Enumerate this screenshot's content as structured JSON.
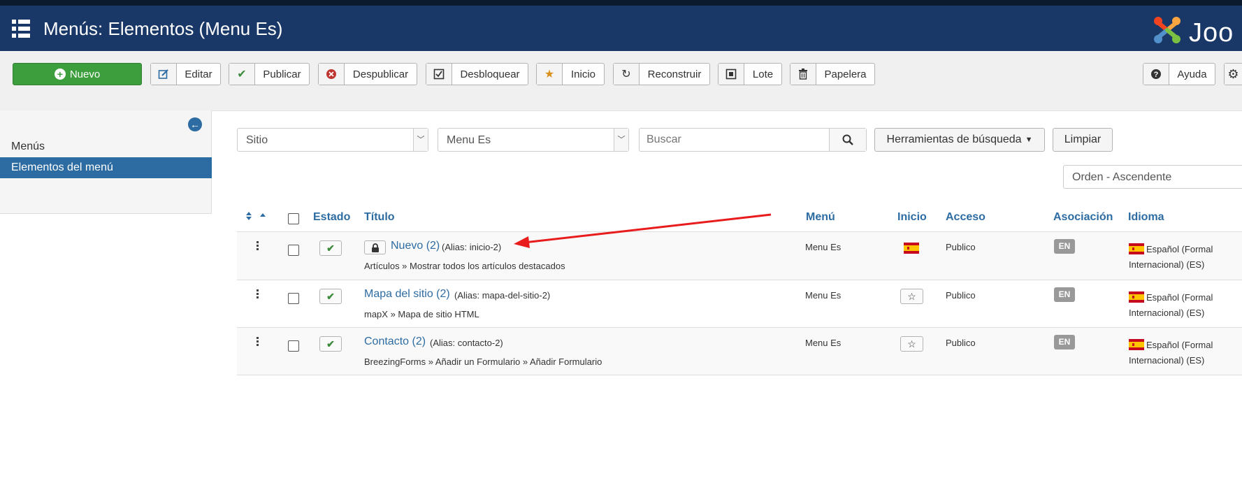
{
  "header": {
    "title": "Menús: Elementos (Menu Es)",
    "logo_text": "Joo"
  },
  "toolbar": {
    "new_label": "Nuevo",
    "edit_label": "Editar",
    "publish_label": "Publicar",
    "unpublish_label": "Despublicar",
    "checkin_label": "Desbloquear",
    "home_label": "Inicio",
    "rebuild_label": "Reconstruir",
    "batch_label": "Lote",
    "trash_label": "Papelera",
    "help_label": "Ayuda"
  },
  "sidebar": {
    "items": [
      {
        "label": "Menús"
      },
      {
        "label": "Elementos del menú"
      }
    ]
  },
  "filters": {
    "client": "Sitio",
    "menu": "Menu Es",
    "search_placeholder": "Buscar",
    "search_tools": "Herramientas de búsqueda",
    "clear": "Limpiar",
    "ordering": "Orden - Ascendente"
  },
  "table": {
    "headers": {
      "status": "Estado",
      "title": "Título",
      "menu": "Menú",
      "home": "Inicio",
      "access": "Acceso",
      "association": "Asociación",
      "language": "Idioma"
    },
    "rows": [
      {
        "title": "Nuevo (2)",
        "alias": "(Alias: inicio-2)",
        "type": "Artículos » Mostrar todos los artículos destacados",
        "menu": "Menu Es",
        "access": "Publico",
        "association": "EN",
        "language": "Español (Formal Internacional) (ES)"
      },
      {
        "title": "Mapa del sitio (2)",
        "alias": "(Alias: mapa-del-sitio-2)",
        "type": "mapX » Mapa de sitio HTML",
        "menu": "Menu Es",
        "access": "Publico",
        "association": "EN",
        "language": "Español (Formal Internacional) (ES)"
      },
      {
        "title": "Contacto (2)",
        "alias": "(Alias: contacto-2)",
        "type": "BreezingForms » Añadir un Formulario » Añadir Formulario",
        "menu": "Menu Es",
        "access": "Publico",
        "association": "EN",
        "language": "Español (Formal Internacional) (ES)"
      }
    ]
  },
  "colors": {
    "header": "#1a3867",
    "accent": "#2d6ca2",
    "annotation_arrow": "#e81c1c",
    "new_button": "#3c9e3c"
  }
}
